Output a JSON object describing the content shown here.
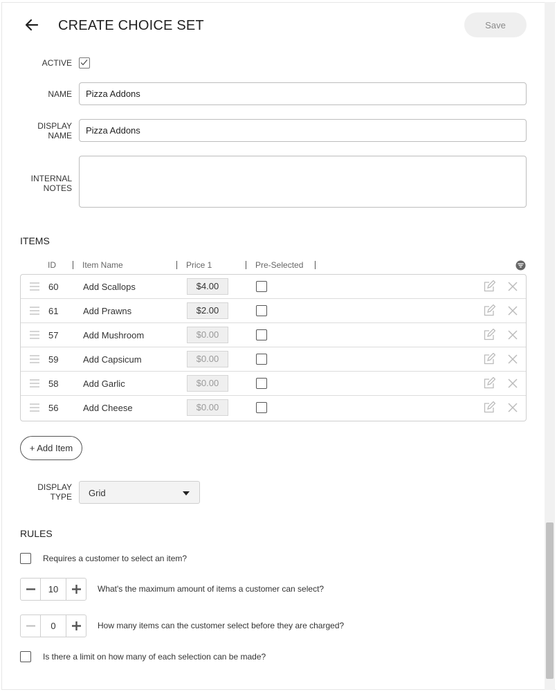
{
  "header": {
    "title": "CREATE CHOICE SET",
    "save_label": "Save"
  },
  "form": {
    "active_label": "ACTIVE",
    "active_checked": true,
    "name_label": "NAME",
    "name_value": "Pizza Addons",
    "display_name_label_line1": "DISPLAY",
    "display_name_label_line2": "NAME",
    "display_name_value": "Pizza Addons",
    "internal_notes_label_line1": "INTERNAL",
    "internal_notes_label_line2": "NOTES",
    "internal_notes_value": ""
  },
  "items": {
    "section_title": "ITEMS",
    "columns": {
      "id": "ID",
      "name": "Item Name",
      "price": "Price 1",
      "preselected": "Pre-Selected"
    },
    "rows": [
      {
        "id": "60",
        "name": "Add Scallops",
        "price": "$4.00",
        "preselected": false
      },
      {
        "id": "61",
        "name": "Add Prawns",
        "price": "$2.00",
        "preselected": false
      },
      {
        "id": "57",
        "name": "Add Mushroom",
        "price": "$0.00",
        "preselected": false
      },
      {
        "id": "59",
        "name": "Add Capsicum",
        "price": "$0.00",
        "preselected": false
      },
      {
        "id": "58",
        "name": "Add Garlic",
        "price": "$0.00",
        "preselected": false
      },
      {
        "id": "56",
        "name": "Add Cheese",
        "price": "$0.00",
        "preselected": false
      }
    ],
    "add_label": "+ Add Item"
  },
  "display_type": {
    "label_line1": "DISPLAY",
    "label_line2": "TYPE",
    "value": "Grid"
  },
  "rules": {
    "section_title": "RULES",
    "requires_select": "Requires a customer to select an item?",
    "max_items_value": "10",
    "max_items_text": "What's the maximum amount of items a customer can select?",
    "free_items_value": "0",
    "free_items_text": "How many items can the customer select before they are charged?",
    "limit_each": "Is there a limit on how many of each selection can be made?"
  },
  "colors": {
    "accent": "#222222",
    "disabled_text": "#9a9a9a",
    "save_bg": "#efefef"
  }
}
